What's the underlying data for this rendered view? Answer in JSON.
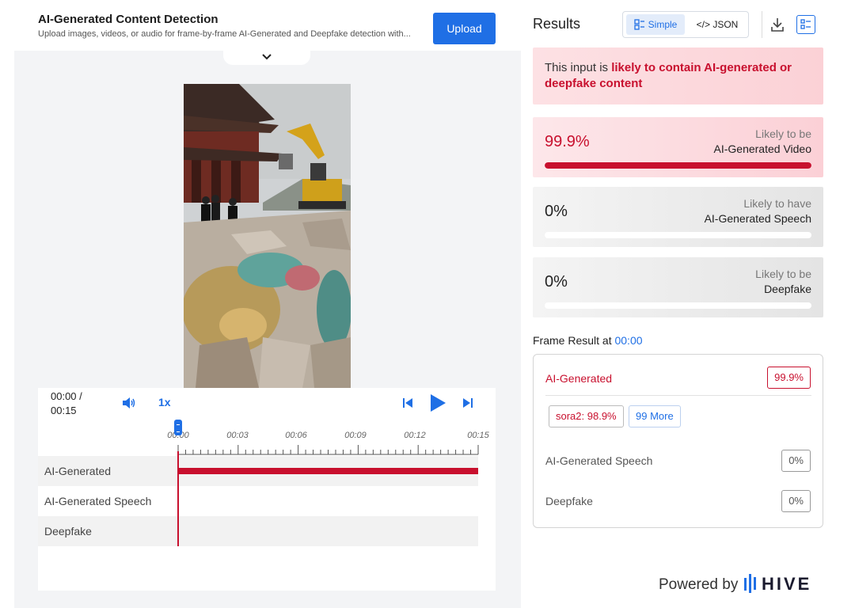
{
  "header": {
    "title": "AI-Generated Content Detection",
    "subtitle": "Upload images, videos, or audio for frame-by-frame AI-Generated and Deepfake detection with...",
    "upload_label": "Upload"
  },
  "player": {
    "time_current": "00:00 /",
    "time_total": "00:15",
    "speed": "1x",
    "ticks": [
      "00:00",
      "00:03",
      "00:06",
      "00:09",
      "00:12",
      "00:15"
    ],
    "tracks": [
      {
        "label": "AI-Generated",
        "coverage": 1.0
      },
      {
        "label": "AI-Generated Speech",
        "coverage": 0
      },
      {
        "label": "Deepfake",
        "coverage": 0
      }
    ]
  },
  "results": {
    "title": "Results",
    "toggle_simple": "Simple",
    "toggle_json": "</> JSON",
    "alert_prefix": "This input is ",
    "alert_emphasis": "likely to contain AI-generated or deepfake content",
    "scores": [
      {
        "value": "99.9%",
        "fraction": 0.999,
        "caption1": "Likely to be",
        "caption2": "AI-Generated Video"
      },
      {
        "value": "0%",
        "fraction": 0,
        "caption1": "Likely to have",
        "caption2": "AI-Generated Speech"
      },
      {
        "value": "0%",
        "fraction": 0,
        "caption1": "Likely to be",
        "caption2": "Deepfake"
      }
    ],
    "frame_result_label": "Frame Result at ",
    "frame_time": "00:00",
    "frame": {
      "ai_label": "AI-Generated",
      "ai_value": "99.9%",
      "chip_model": "sora2: 98.9%",
      "chip_more": "99 More",
      "speech_label": "AI-Generated Speech",
      "speech_value": "0%",
      "deepfake_label": "Deepfake",
      "deepfake_value": "0%"
    }
  },
  "footer": {
    "powered_by": "Powered by",
    "brand": "HIVE"
  },
  "colors": {
    "accent": "#1f6fe5",
    "danger": "#c8102e"
  }
}
